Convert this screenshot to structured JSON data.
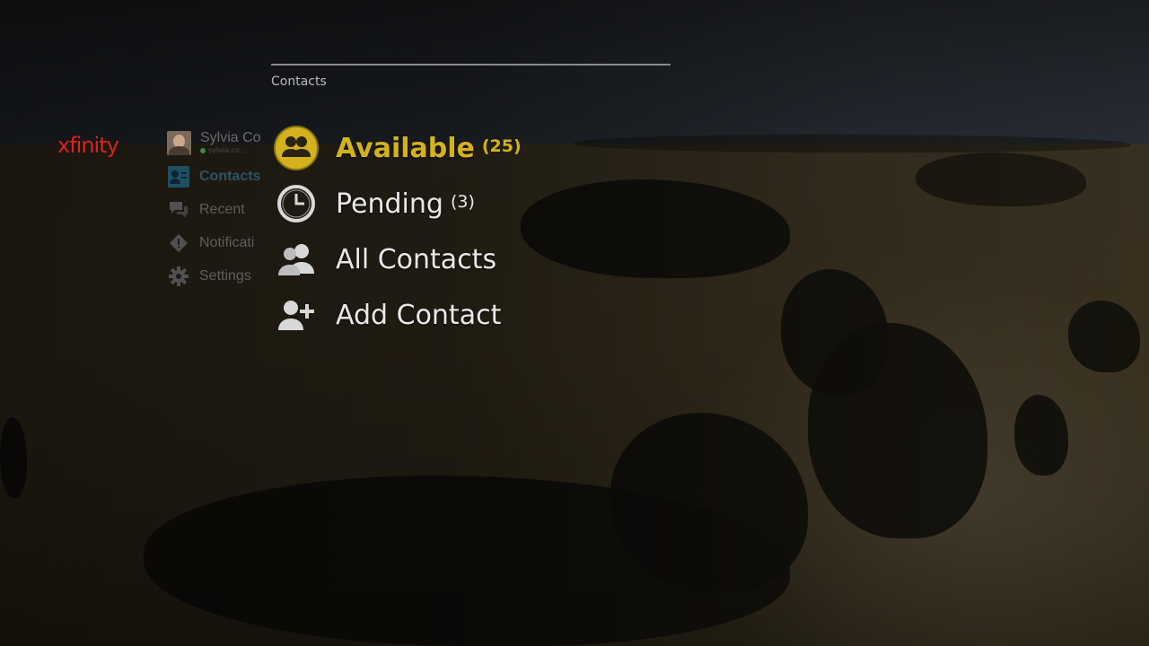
{
  "brand": {
    "logo_text": "xfinity",
    "logo_color": "#d9231e"
  },
  "sidebar": {
    "user": {
      "name": "Sylvia Co",
      "email": "sylvia.co...",
      "status_color": "#3d8a3d"
    },
    "items": [
      {
        "label": "Contacts",
        "icon": "contacts-icon",
        "active": true
      },
      {
        "label": "Recent",
        "icon": "recent-chat-icon"
      },
      {
        "label": "Notificati",
        "icon": "notification-icon"
      },
      {
        "label": "Settings",
        "icon": "gear-icon"
      }
    ]
  },
  "main": {
    "section_title": "Contacts",
    "accent_color": "#d4b21e",
    "items": [
      {
        "label": "Available",
        "count": "(25)",
        "icon": "available-contacts-icon",
        "selected": true
      },
      {
        "label": "Pending",
        "count": "(3)",
        "icon": "clock-icon"
      },
      {
        "label": "All Contacts",
        "count": "",
        "icon": "all-contacts-icon"
      },
      {
        "label": "Add Contact",
        "count": "",
        "icon": "add-contact-icon"
      }
    ]
  }
}
